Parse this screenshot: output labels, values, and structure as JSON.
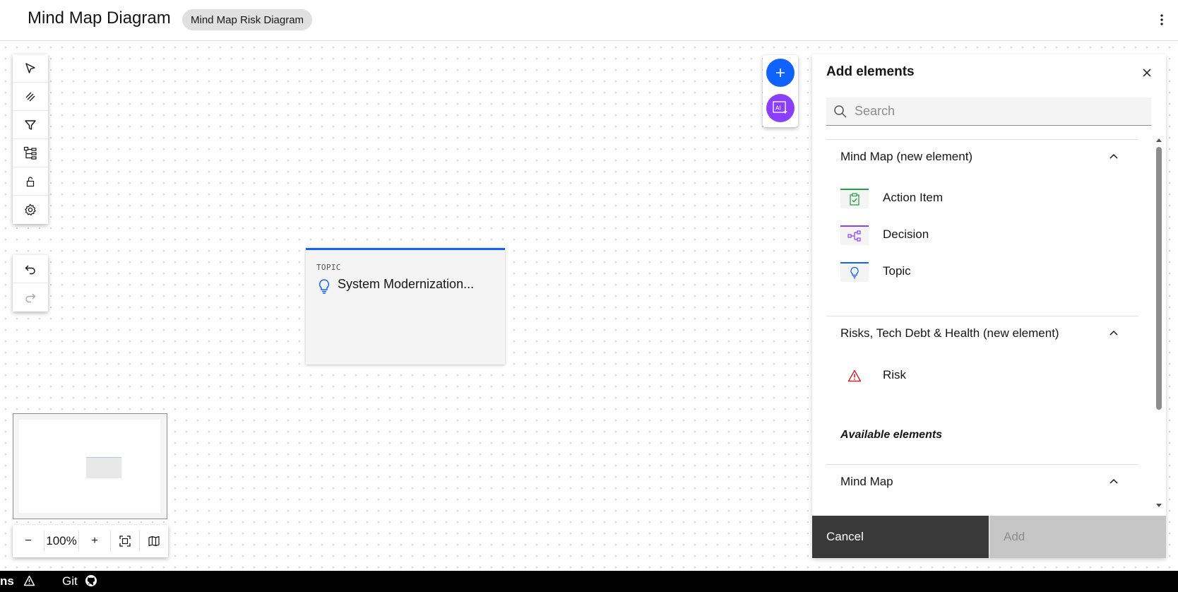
{
  "header": {
    "title": "Mind Map Diagram",
    "tag": "Mind Map Risk Diagram"
  },
  "canvas": {
    "node": {
      "type": "TOPIC",
      "title": "System Modernization..."
    },
    "zoom": {
      "level": "100%",
      "minus": "−",
      "plus": "+"
    }
  },
  "panel": {
    "title": "Add elements",
    "search_placeholder": "Search",
    "sections": [
      {
        "label": "Mind Map (new element)",
        "items": [
          {
            "label": "Action Item",
            "icon": "clipboard-check-icon",
            "color": "#24a148"
          },
          {
            "label": "Decision",
            "icon": "decision-tree-icon",
            "color": "#8a3ffc"
          },
          {
            "label": "Topic",
            "icon": "lightbulb-icon",
            "color": "#0f62fe"
          }
        ]
      },
      {
        "label": "Risks, Tech Debt & Health (new element)",
        "items": [
          {
            "label": "Risk",
            "icon": "warning-triangle-icon",
            "color": "#da1e28"
          }
        ]
      }
    ],
    "available_heading": "Available elements",
    "available_sections": [
      {
        "label": "Mind Map"
      }
    ],
    "cancel_label": "Cancel",
    "add_label": "Add"
  },
  "status": {
    "left_text": "ns",
    "git_label": "Git"
  },
  "colors": {
    "accent": "#0f62fe",
    "fab_add": "#0f62fe",
    "fab_ai": "#8a3ffc"
  }
}
